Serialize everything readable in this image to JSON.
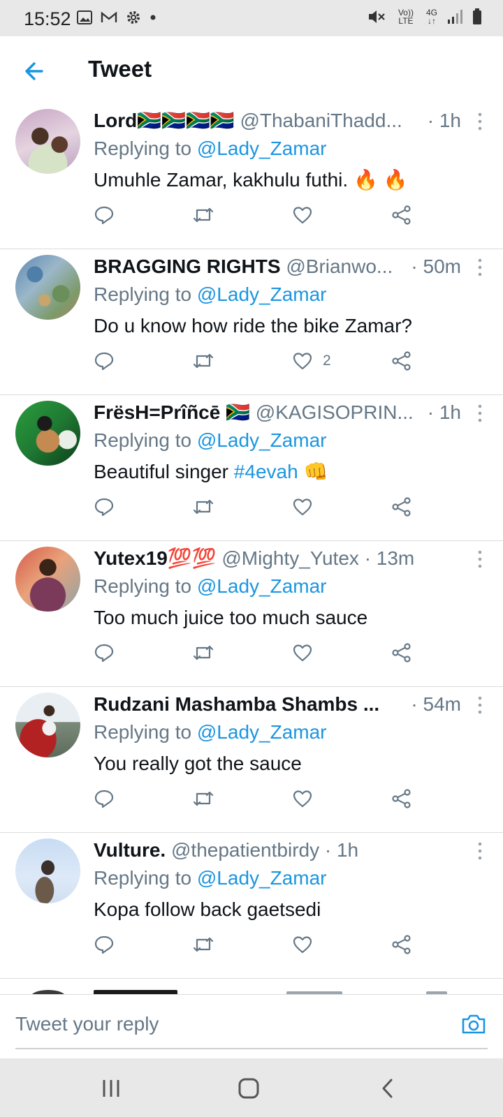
{
  "status": {
    "time": "15:52",
    "network": "4G",
    "volte": "Vo)) LTE"
  },
  "appbar": {
    "title": "Tweet"
  },
  "reply_label": "Replying to",
  "tweets": [
    {
      "name": "Lord",
      "flags": "🇿🇦🇿🇦🇿🇦🇿🇦",
      "handle": "@ThabaniThadd...",
      "time": "· 1h",
      "reply_to": "@Lady_Zamar",
      "text": "Umuhle Zamar, kakhulu futhi. 🔥 🔥",
      "tag": "",
      "emoji": "",
      "likes": ""
    },
    {
      "name": "BRAGGING RIGHTS",
      "flags": "",
      "handle": "@Brianwo...",
      "time": "· 50m",
      "reply_to": "@Lady_Zamar",
      "text": "Do u know how ride the bike Zamar?",
      "tag": "",
      "emoji": "",
      "likes": "2"
    },
    {
      "name": "FrësH=Prîñcē",
      "flags": "🇿🇦",
      "handle": "@KAGISOPRIN...",
      "time": "· 1h",
      "reply_to": "@Lady_Zamar",
      "text": "Beautiful singer ",
      "tag": "#4evah",
      "emoji": " 👊",
      "likes": ""
    },
    {
      "name": "Yutex19",
      "flags": "💯💯",
      "handle": "@Mighty_Yutex",
      "time": "· 13m",
      "reply_to": "@Lady_Zamar",
      "text": "Too much juice too much sauce",
      "tag": "",
      "emoji": "",
      "likes": ""
    },
    {
      "name": "Rudzani Mashamba Shambs ...",
      "flags": "",
      "handle": "",
      "time": "· 54m",
      "reply_to": "@Lady_Zamar",
      "text": "You really got the sauce",
      "tag": "",
      "emoji": "",
      "likes": ""
    },
    {
      "name": "Vulture.",
      "flags": "",
      "handle": "@thepatientbirdy",
      "time": "· 1h",
      "reply_to": "@Lady_Zamar",
      "text": "Kopa follow back gaetsedi",
      "tag": "",
      "emoji": "",
      "likes": ""
    }
  ],
  "compose": {
    "placeholder": "Tweet your reply"
  },
  "colors": {
    "accent": "#1b95e0",
    "secondary_text": "#657786",
    "primary_text": "#0f1419"
  }
}
